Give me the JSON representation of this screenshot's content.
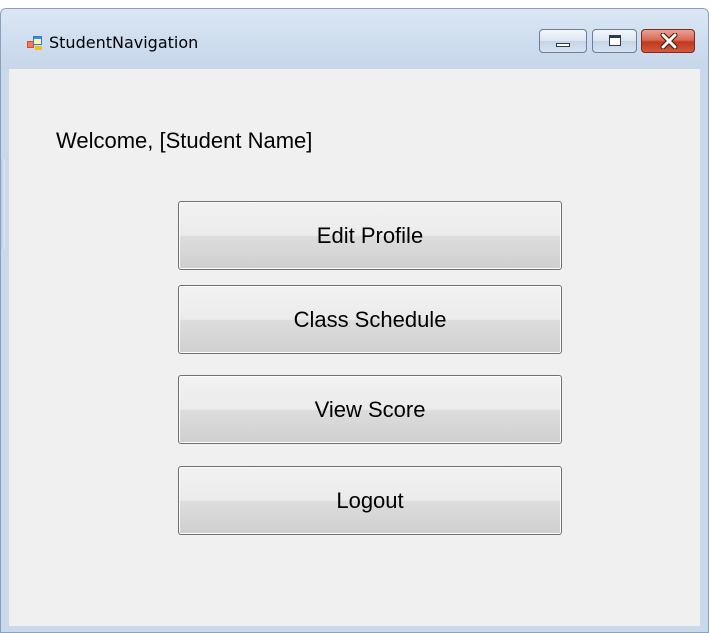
{
  "window": {
    "title": "StudentNavigation",
    "icon": "app-form-icon"
  },
  "window_controls": {
    "minimize": "minimize-icon",
    "maximize": "maximize-icon",
    "close": "close-icon"
  },
  "main": {
    "welcome_text": "Welcome, [Student Name]",
    "buttons": [
      {
        "label": "Edit Profile"
      },
      {
        "label": "Class Schedule"
      },
      {
        "label": "View Score"
      },
      {
        "label": "Logout"
      }
    ]
  },
  "colors": {
    "client_background": "#f0f0f0",
    "frame": "#c9d9ec",
    "close_button": "#c0391f"
  }
}
